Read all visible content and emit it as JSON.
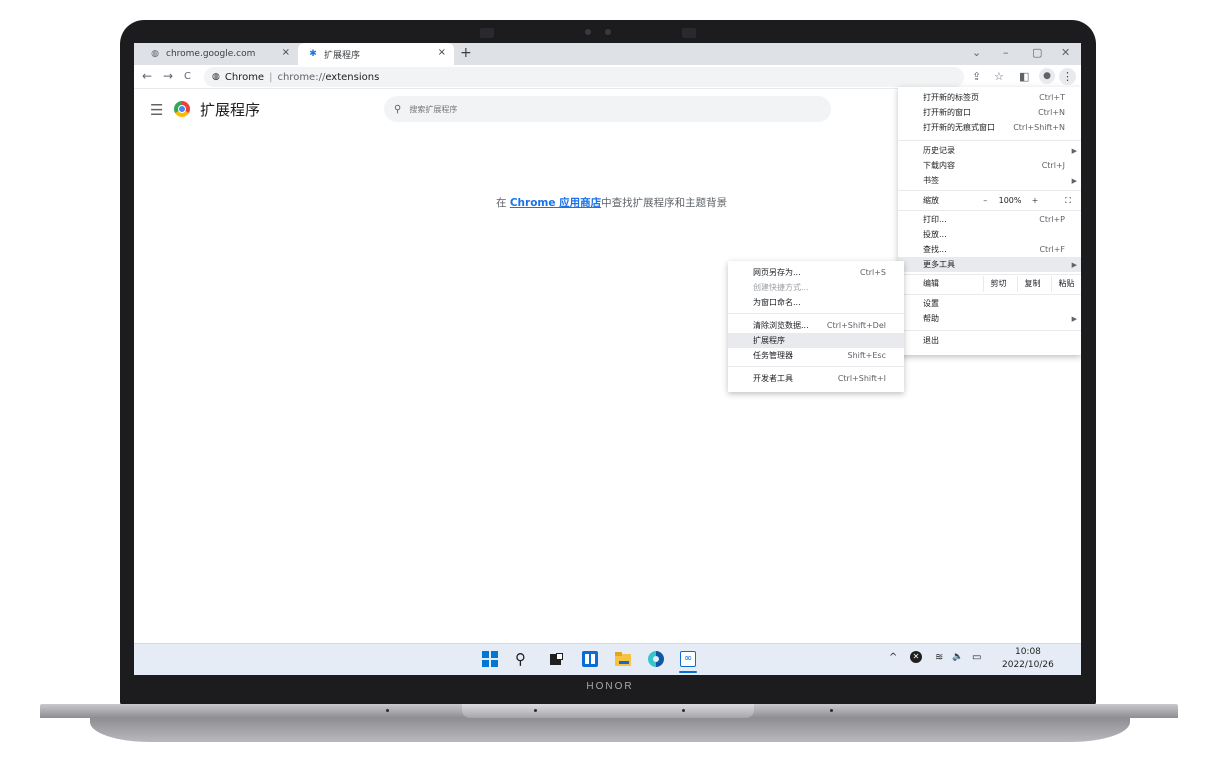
{
  "device": {
    "brand": "HONOR"
  },
  "browser": {
    "tabs": [
      {
        "icon": "chrome-globe-icon",
        "label": "chrome.google.com",
        "close": "×"
      },
      {
        "icon": "puzzle-icon",
        "label": "扩展程序",
        "close": "×"
      }
    ],
    "new_tab": "+",
    "window_controls": {
      "tab_search": "⌄",
      "minimize": "–",
      "restore": "▢",
      "close": "✕"
    },
    "nav": {
      "back": "←",
      "forward": "→",
      "reload": "C"
    },
    "omnibox": {
      "site_label": "Chrome",
      "separator": "|",
      "scheme": "chrome://",
      "path": "extensions"
    },
    "toolbar_icons": {
      "share": "⇪",
      "bookmark": "☆",
      "sidepanel": "◧",
      "profile": "●",
      "menu": "⋮"
    }
  },
  "page": {
    "title": "扩展程序",
    "search_placeholder": "搜索扩展程序",
    "store_prefix": "在 ",
    "store_link": "Chrome 应用商店",
    "store_suffix": "中查找扩展程序和主题背景"
  },
  "main_menu": {
    "new_tab": {
      "label": "打开新的标签页",
      "shortcut": "Ctrl+T"
    },
    "new_window": {
      "label": "打开新的窗口",
      "shortcut": "Ctrl+N"
    },
    "incognito": {
      "label": "打开新的无痕式窗口",
      "shortcut": "Ctrl+Shift+N"
    },
    "history": {
      "label": "历史记录"
    },
    "downloads": {
      "label": "下载内容",
      "shortcut": "Ctrl+J"
    },
    "bookmarks": {
      "label": "书签"
    },
    "zoom": {
      "label": "缩放",
      "minus": "–",
      "value": "100%",
      "plus": "+",
      "fullscreen": "⛶"
    },
    "print": {
      "label": "打印...",
      "shortcut": "Ctrl+P"
    },
    "cast": {
      "label": "投放..."
    },
    "find": {
      "label": "查找...",
      "shortcut": "Ctrl+F"
    },
    "more_tools": {
      "label": "更多工具"
    },
    "edit": {
      "label": "编辑",
      "cut": "剪切",
      "copy": "复制",
      "paste": "粘贴"
    },
    "settings": {
      "label": "设置"
    },
    "help": {
      "label": "帮助"
    },
    "exit": {
      "label": "退出"
    }
  },
  "more_tools_menu": {
    "save_page": {
      "label": "网页另存为...",
      "shortcut": "Ctrl+S"
    },
    "create_shortcut": {
      "label": "创建快捷方式..."
    },
    "name_window": {
      "label": "为窗口命名..."
    },
    "clear_data": {
      "label": "清除浏览数据...",
      "shortcut": "Ctrl+Shift+Del"
    },
    "extensions": {
      "label": "扩展程序"
    },
    "task_manager": {
      "label": "任务管理器",
      "shortcut": "Shift+Esc"
    },
    "dev_tools": {
      "label": "开发者工具",
      "shortcut": "Ctrl+Shift+I"
    }
  },
  "taskbar": {
    "tray": {
      "chevron": "^",
      "wifi": "≋",
      "volume": "🔈",
      "battery": "▭"
    },
    "time": "10:08",
    "date": "2022/10/26"
  },
  "colors": {
    "accent": "#1a73e8",
    "taskbar": "#e6ecf5",
    "tabstrip": "#dee1e6"
  }
}
